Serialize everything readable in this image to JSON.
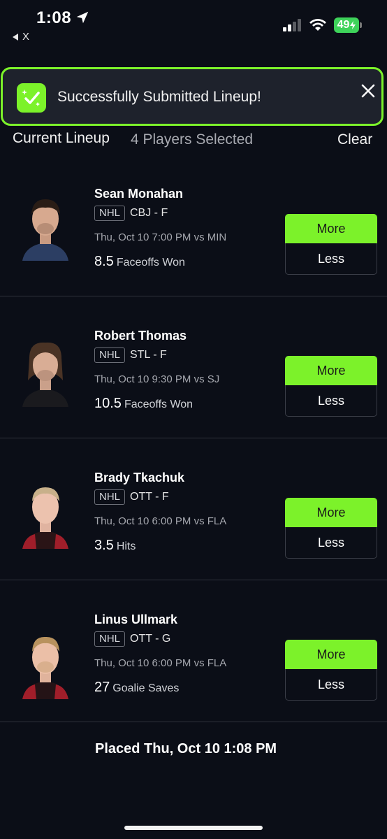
{
  "status_bar": {
    "time": "1:08",
    "back_label": "X",
    "battery": "49"
  },
  "toast": {
    "message": "Successfully Submitted Lineup!"
  },
  "header": {
    "title": "Current Lineup",
    "count": "4 Players Selected",
    "clear": "Clear"
  },
  "players": [
    {
      "name": "Sean Monahan",
      "league": "NHL",
      "team": "CBJ - F",
      "game": "Thu, Oct 10 7:00 PM vs MIN",
      "value": "8.5",
      "stat": "Faceoffs Won",
      "more": "More",
      "less": "Less"
    },
    {
      "name": "Robert Thomas",
      "league": "NHL",
      "team": "STL - F",
      "game": "Thu, Oct 10 9:30 PM vs SJ",
      "value": "10.5",
      "stat": "Faceoffs Won",
      "more": "More",
      "less": "Less"
    },
    {
      "name": "Brady Tkachuk",
      "league": "NHL",
      "team": "OTT - F",
      "game": "Thu, Oct 10 6:00 PM vs FLA",
      "value": "3.5",
      "stat": "Hits",
      "more": "More",
      "less": "Less"
    },
    {
      "name": "Linus Ullmark",
      "league": "NHL",
      "team": "OTT - G",
      "game": "Thu, Oct 10 6:00 PM vs FLA",
      "value": "27",
      "stat": "Goalie Saves",
      "more": "More",
      "less": "Less"
    }
  ],
  "footer": {
    "placed": "Placed Thu, Oct 10 1:08 PM"
  },
  "colors": {
    "accent": "#7cf22a",
    "background": "#0b0e17",
    "toast_bg": "#1e222c"
  }
}
